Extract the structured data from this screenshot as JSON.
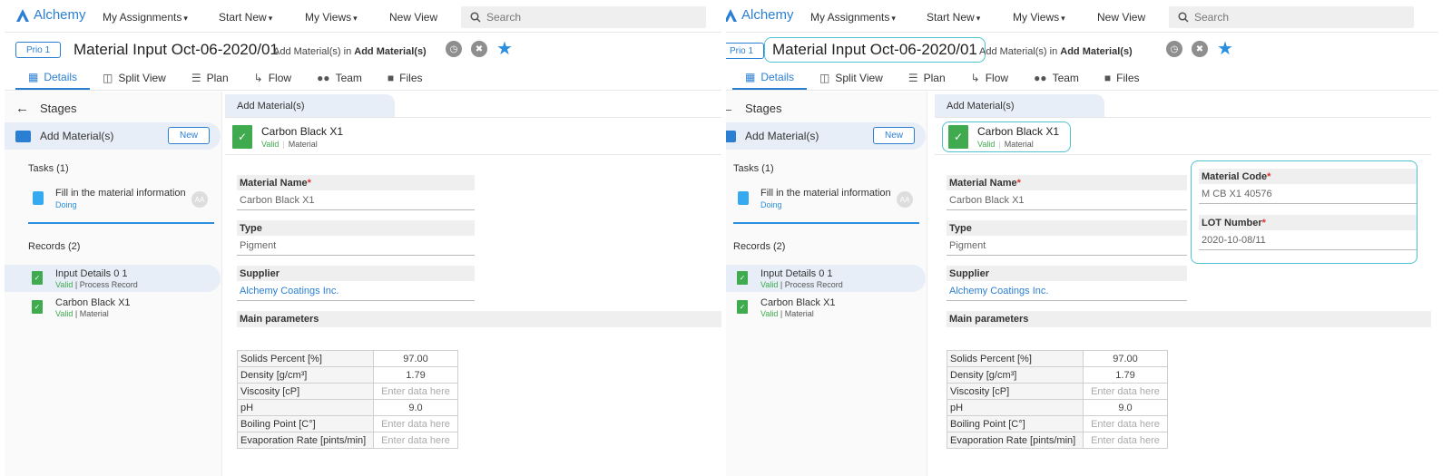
{
  "app": {
    "name": "Alchemy"
  },
  "nav": {
    "my_assignments": "My Assignments",
    "start_new": "Start New",
    "my_views": "My Views",
    "new_view": "New View",
    "search_placeholder": "Search"
  },
  "header": {
    "prio": "Prio 1",
    "title": "Material Input Oct-06-2020/01",
    "subtitle_prefix": "Add Material(s) in",
    "subtitle_stage": "Add Material(s)"
  },
  "tabs": [
    "Details",
    "Split View",
    "Plan",
    "Flow",
    "Team",
    "Files"
  ],
  "sidebar": {
    "stages_label": "Stages",
    "stage": "Add Material(s)",
    "new_button": "New",
    "tasks_label": "Tasks (1)",
    "task": {
      "title": "Fill in the material information",
      "status": "Doing",
      "avatar": "AA"
    },
    "records_label": "Records (2)",
    "records": [
      {
        "title": "Input Details 0 1",
        "status": "Valid",
        "type": "Process Record"
      },
      {
        "title": "Carbon Black X1",
        "status": "Valid",
        "type": "Material"
      }
    ]
  },
  "main": {
    "breadcrumb": "Add Material(s)",
    "material": {
      "name": "Carbon Black X1",
      "status": "Valid",
      "type": "Material"
    },
    "fields": {
      "material_name": {
        "label": "Material Name",
        "value": "Carbon Black X1"
      },
      "type": {
        "label": "Type",
        "value": "Pigment"
      },
      "supplier": {
        "label": "Supplier",
        "value": "Alchemy Coatings Inc."
      },
      "material_code": {
        "label": "Material Code",
        "value": "M CB X1 40576"
      },
      "lot_number": {
        "label": "LOT Number",
        "value": "2020-10-08/11"
      }
    },
    "main_parameters": "Main parameters",
    "parameters": [
      {
        "name": "Solids Percent [%]",
        "value": "97.00"
      },
      {
        "name": "Density [g/cm³]",
        "value": "1.79"
      },
      {
        "name": "Viscosity [cP]",
        "value": "Enter data here"
      },
      {
        "name": "pH",
        "value": "9.0"
      },
      {
        "name": "Boiling Point [C°]",
        "value": "Enter data here"
      },
      {
        "name": "Evaporation Rate [pints/min]",
        "value": "Enter data here"
      }
    ]
  },
  "colors": {
    "accent": "#2b7fd3",
    "valid": "#3faa4e",
    "highlight": "#4ec3cf"
  }
}
